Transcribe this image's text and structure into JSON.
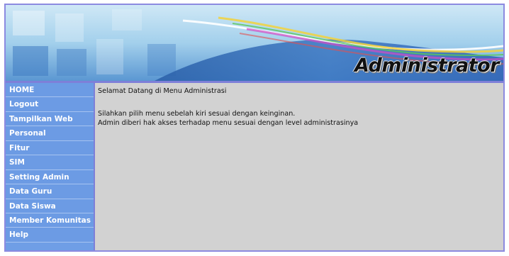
{
  "banner": {
    "title": "Administrator"
  },
  "sidebar": {
    "items": [
      {
        "label": "HOME"
      },
      {
        "label": "Logout"
      },
      {
        "label": "Tampilkan Web"
      },
      {
        "label": "Personal"
      },
      {
        "label": "Fitur"
      },
      {
        "label": "SIM"
      },
      {
        "label": "Setting Admin"
      },
      {
        "label": "Data Guru"
      },
      {
        "label": "Data Siswa"
      },
      {
        "label": "Member Komunitas"
      },
      {
        "label": "Help"
      }
    ]
  },
  "content": {
    "welcome": "Selamat Datang di Menu Administrasi",
    "line1": "Silahkan pilih menu sebelah kiri sesuai dengan keinginan.",
    "line2": "Admin diberi hak akses terhadap menu sesuai dengan level administrasinya"
  },
  "colors": {
    "border": "#8c8ae0",
    "menu_bg": "#6c9be4",
    "content_bg": "#d2d2d2"
  }
}
